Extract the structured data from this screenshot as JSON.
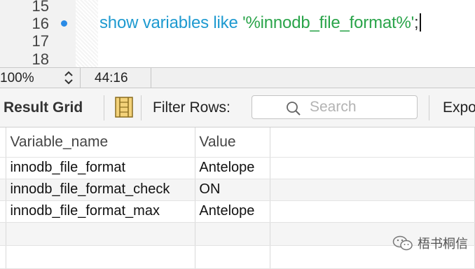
{
  "editor": {
    "line_numbers": [
      "15",
      "16",
      "17",
      "18"
    ],
    "code": {
      "keywords": "show variables like ",
      "string": "'%innodb_file_format%'",
      "terminator": ";"
    }
  },
  "status_bar": {
    "zoom": "100%",
    "cursor_position": "44:16"
  },
  "toolbar": {
    "result_grid_label": "Result Grid",
    "filter_label": "Filter Rows:",
    "search_placeholder": "Search",
    "export_label": "Expo"
  },
  "grid": {
    "columns": [
      "Variable_name",
      "Value"
    ],
    "rows": [
      [
        "innodb_file_format",
        "Antelope"
      ],
      [
        "innodb_file_format_check",
        "ON"
      ],
      [
        "innodb_file_format_max",
        "Antelope"
      ]
    ]
  },
  "watermark": {
    "text": "梧书桐信"
  },
  "colors": {
    "keyword": "#1e9ad0",
    "string": "#2aa44a",
    "breakpoint": "#2a8be6"
  }
}
